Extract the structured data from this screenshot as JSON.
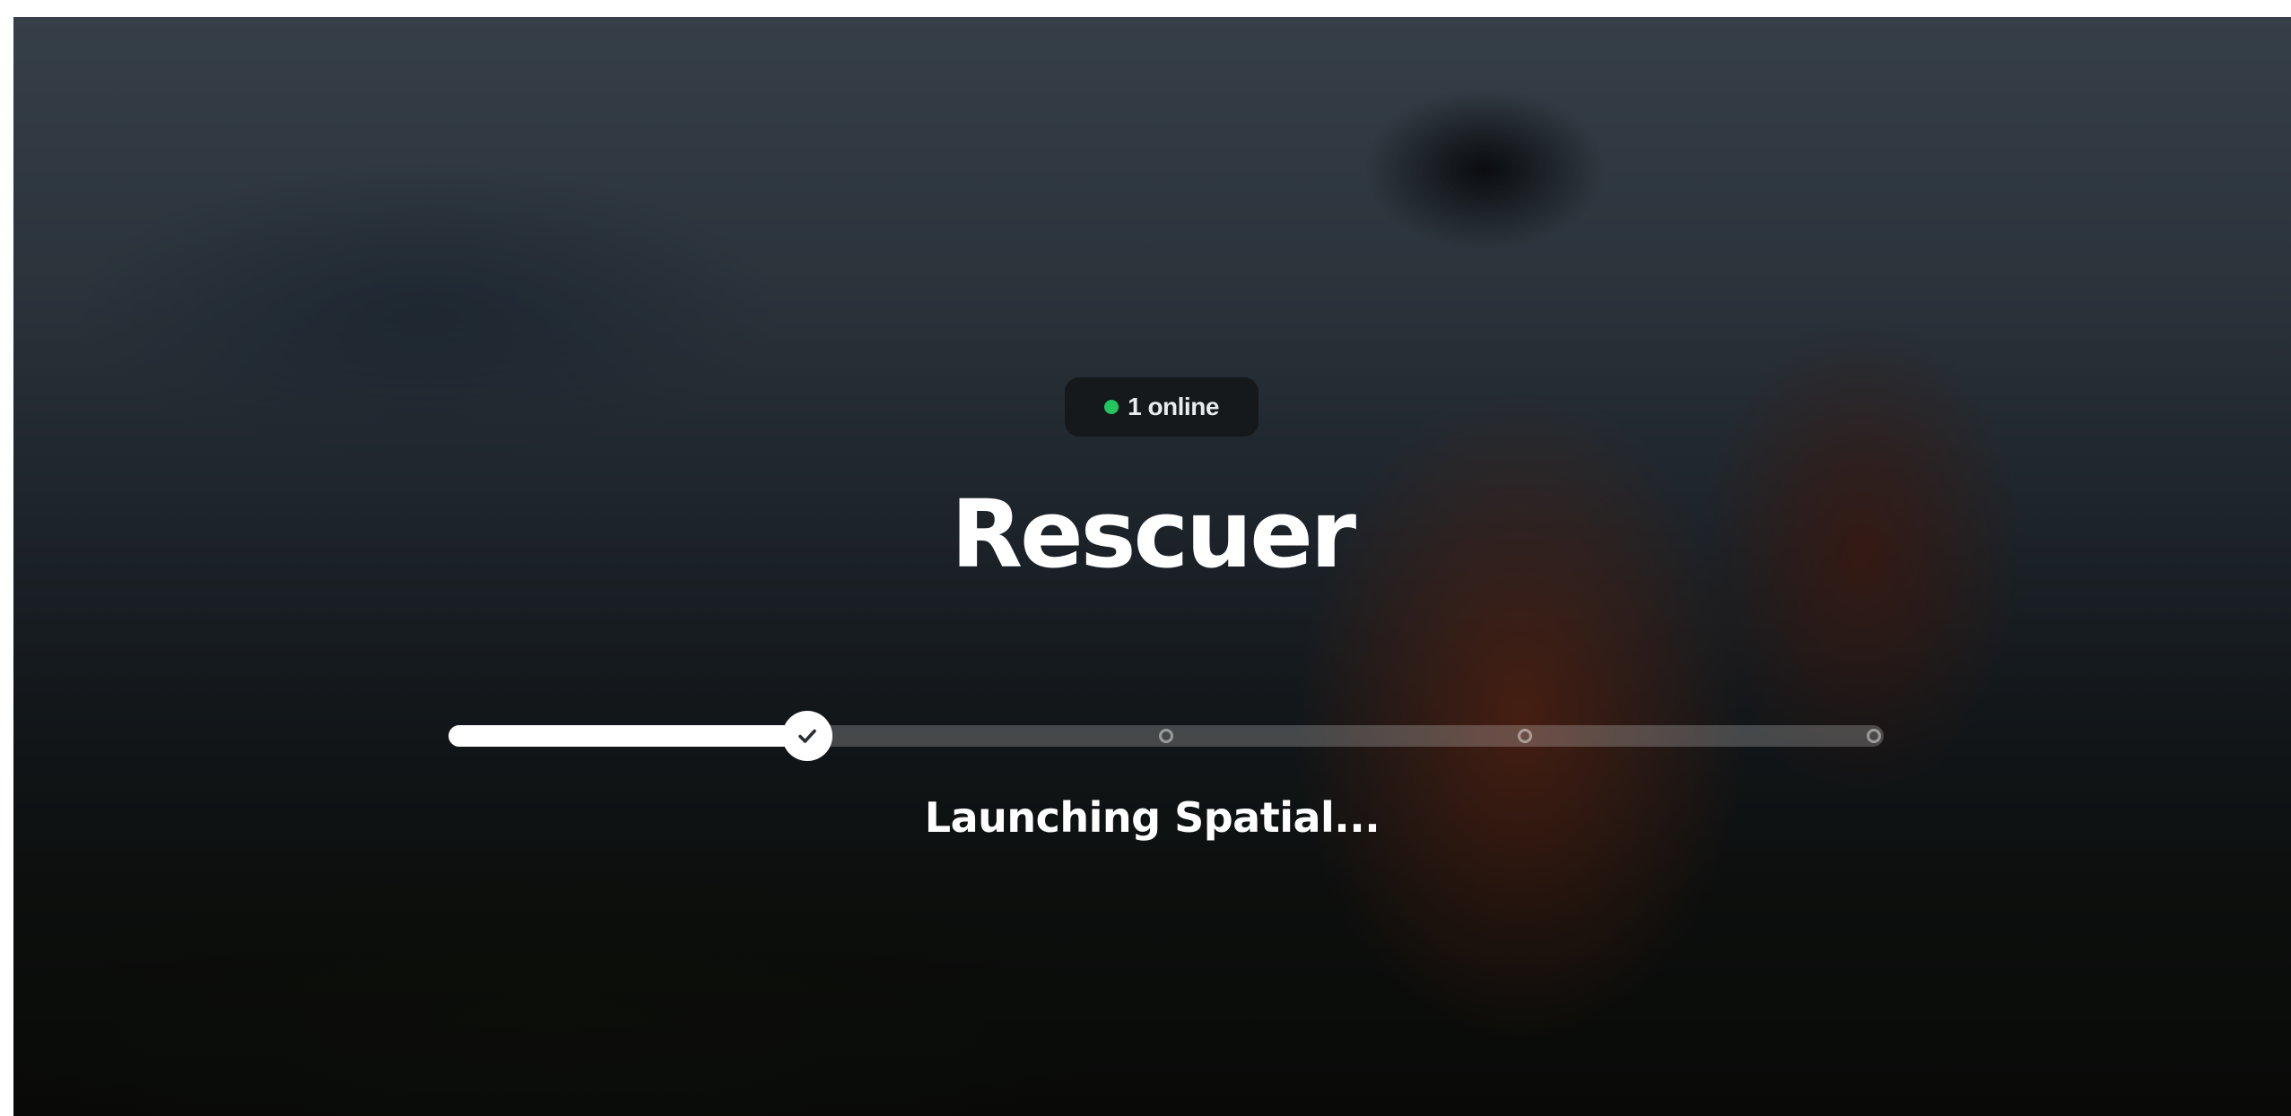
{
  "presence": {
    "count_label": "1 online",
    "dot_color": "#22c55e"
  },
  "app": {
    "title": "Rescuer"
  },
  "progress": {
    "fraction": 0.25,
    "steps": [
      {
        "state": "complete",
        "icon": "check-icon"
      },
      {
        "state": "pending"
      },
      {
        "state": "pending"
      },
      {
        "state": "pending"
      }
    ]
  },
  "status": {
    "text": "Launching Spatial..."
  },
  "colors": {
    "accent": "#ffffff",
    "online": "#22c55e",
    "badge_bg": "#15191b"
  }
}
